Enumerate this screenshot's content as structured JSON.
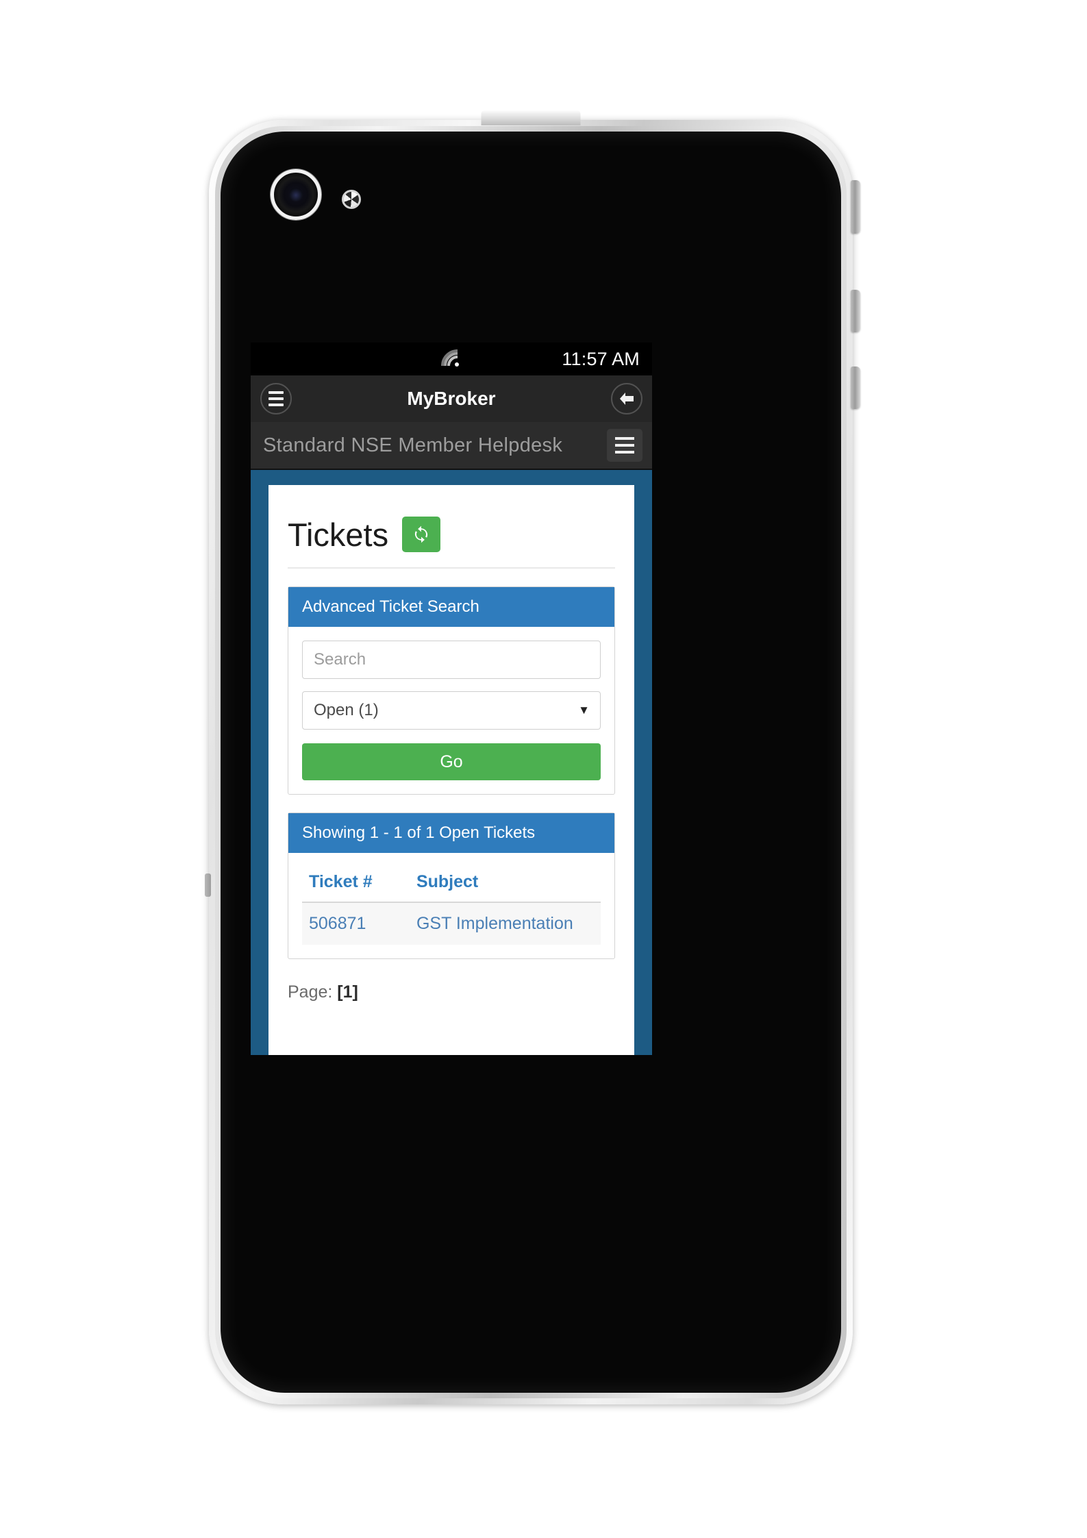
{
  "status_bar": {
    "wifi_icon": "wifi-icon",
    "time": "11:57 AM"
  },
  "app_bar": {
    "menu_icon": "hamburger-menu-icon",
    "title": "MyBroker",
    "back_icon": "back-arrow-icon"
  },
  "nav_bar": {
    "brand": "Standard NSE Member Helpdesk",
    "toggle_icon": "navbar-toggle-icon"
  },
  "page": {
    "title": "Tickets",
    "refresh_icon": "refresh-icon"
  },
  "search_panel": {
    "heading": "Advanced Ticket Search",
    "search_placeholder": "Search",
    "search_value": "",
    "status_selected": "Open (1)",
    "status_options": [
      "Open (1)"
    ],
    "caret_icon": "chevron-down-icon",
    "go_label": "Go"
  },
  "list_panel": {
    "heading": "Showing  1 - 1 of 1 Open Tickets",
    "columns": [
      "Ticket #",
      "Subject"
    ],
    "rows": [
      {
        "ticket": "506871",
        "subject": "GST Implementation"
      }
    ]
  },
  "pagination": {
    "label": "Page:",
    "current": "[1]"
  },
  "colors": {
    "screen_background": "#1d5b84",
    "panel_header_blue": "#2f7cbd",
    "accent_green": "#4cb050",
    "app_bar": "#262626",
    "nav_bar": "#2c2c2c",
    "link_blue": "#4a7fb5"
  }
}
